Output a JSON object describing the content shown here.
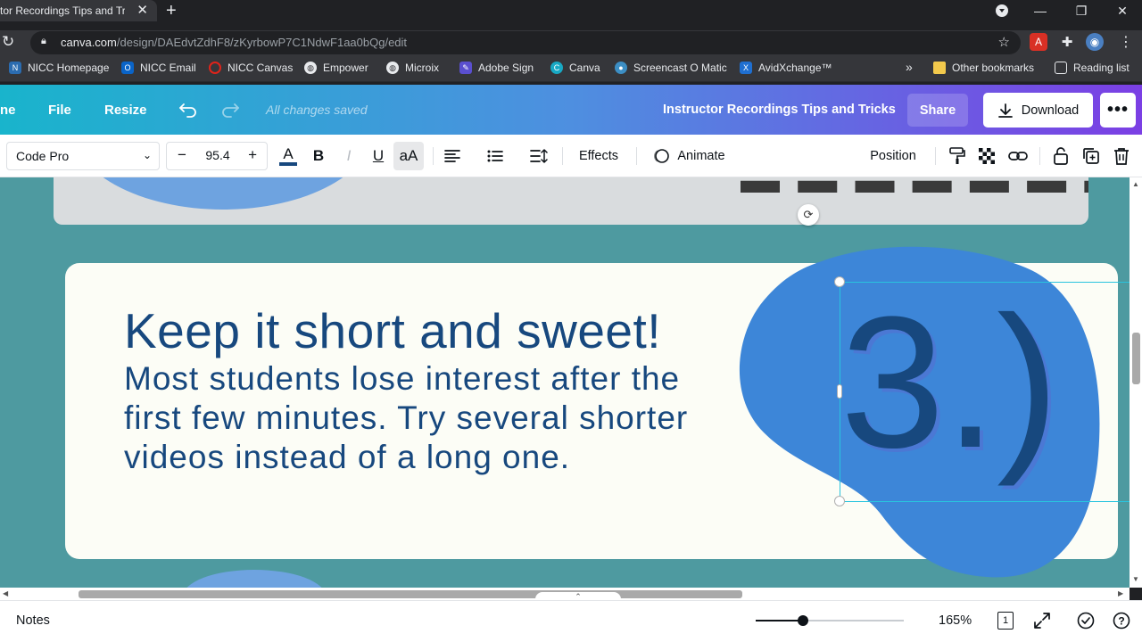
{
  "browser": {
    "tab_title": "ctor Recordings Tips and Tr",
    "url_host": "canva.com",
    "url_path": "/design/DAEdvtZdhF8/zKyrbowP7C1NdwF1aa0bQg/edit"
  },
  "bookmarks": {
    "items": [
      {
        "label": "NICC Homepage",
        "icon": "nicc-icon",
        "color": "#2b6cb0"
      },
      {
        "label": "NICC Email",
        "icon": "outlook-icon",
        "color": "#0a64c8"
      },
      {
        "label": "NICC Canvas",
        "icon": "canvas-lms-icon",
        "color": "#e0231a"
      },
      {
        "label": "Empower",
        "icon": "globe-icon",
        "color": "#5f6368"
      },
      {
        "label": "Microix",
        "icon": "globe-icon",
        "color": "#5f6368"
      },
      {
        "label": "Adobe Sign",
        "icon": "adobe-sign-icon",
        "color": "#5a4fcf"
      },
      {
        "label": "Canva",
        "icon": "canva-icon",
        "color": "#18a9c4"
      },
      {
        "label": "Screencast O Matic",
        "icon": "screencast-icon",
        "color": "#3c8ec4"
      },
      {
        "label": "AvidXchange™",
        "icon": "avidxchange-icon",
        "color": "#1f6fd1"
      }
    ],
    "overflow": "»",
    "other": "Other bookmarks",
    "reading_list": "Reading list"
  },
  "header": {
    "home": "ne",
    "file": "File",
    "resize": "Resize",
    "saved_status": "All changes saved",
    "design_title": "Instructor Recordings Tips and Tricks",
    "share": "Share",
    "download": "Download"
  },
  "toolbar": {
    "font": "Code Pro",
    "size_minus": "−",
    "font_size": "95.4",
    "size_plus": "+",
    "bold": "B",
    "italic": "I",
    "underline": "U",
    "case": "aA",
    "effects": "Effects",
    "animate": "Animate",
    "position": "Position"
  },
  "canvas": {
    "heading": "Keep it short and sweet!",
    "body": "Most students lose interest after the first few minutes. Try several shorter videos instead of a long one.",
    "number": "3.)",
    "colors": {
      "background": "#4e9aa0",
      "card": "#fcfdf6",
      "blob": "#3d86d8",
      "text": "#17487e"
    }
  },
  "footer": {
    "notes": "Notes",
    "zoom": "165%",
    "zoom_level": 0.32,
    "page_count": "1"
  }
}
